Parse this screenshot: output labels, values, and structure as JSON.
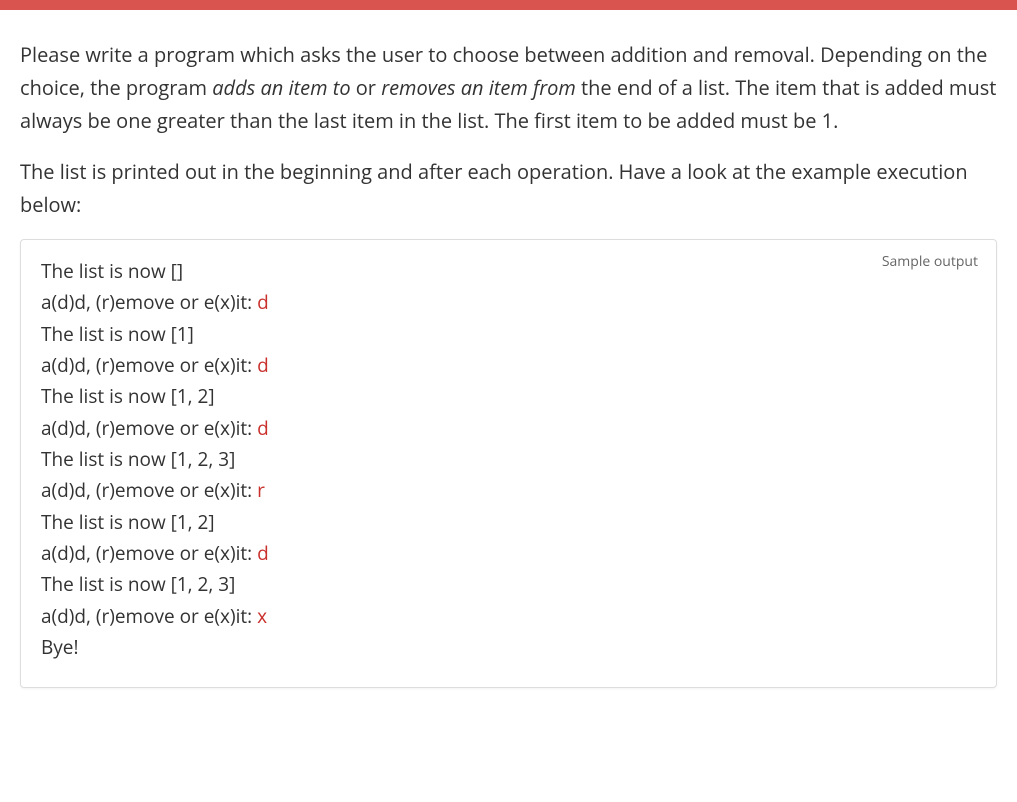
{
  "description": {
    "p1_part1": "Please write a program which asks the user to choose between addition and removal. Depending on the choice, the program ",
    "p1_italic1": "adds an item to",
    "p1_part2": " or ",
    "p1_italic2": "removes an item from",
    "p1_part3": " the end of a list. The item that is added must always be one greater than the last item in the list. The first item to be added must be 1.",
    "p2": "The list is printed out in the beginning and after each operation. Have a look at the example execution below:"
  },
  "output": {
    "label": "Sample output",
    "lines": [
      {
        "prompt": "The list is now []",
        "input": ""
      },
      {
        "prompt": "a(d)d, (r)emove or e(x)it: ",
        "input": "d"
      },
      {
        "prompt": "The list is now [1]",
        "input": ""
      },
      {
        "prompt": "a(d)d, (r)emove or e(x)it: ",
        "input": "d"
      },
      {
        "prompt": "The list is now [1, 2]",
        "input": ""
      },
      {
        "prompt": "a(d)d, (r)emove or e(x)it: ",
        "input": "d"
      },
      {
        "prompt": "The list is now [1, 2, 3]",
        "input": ""
      },
      {
        "prompt": "a(d)d, (r)emove or e(x)it: ",
        "input": "r"
      },
      {
        "prompt": "The list is now [1, 2]",
        "input": ""
      },
      {
        "prompt": "a(d)d, (r)emove or e(x)it: ",
        "input": "d"
      },
      {
        "prompt": "The list is now [1, 2, 3]",
        "input": ""
      },
      {
        "prompt": "a(d)d, (r)emove or e(x)it: ",
        "input": "x"
      },
      {
        "prompt": "Bye!",
        "input": ""
      }
    ]
  }
}
